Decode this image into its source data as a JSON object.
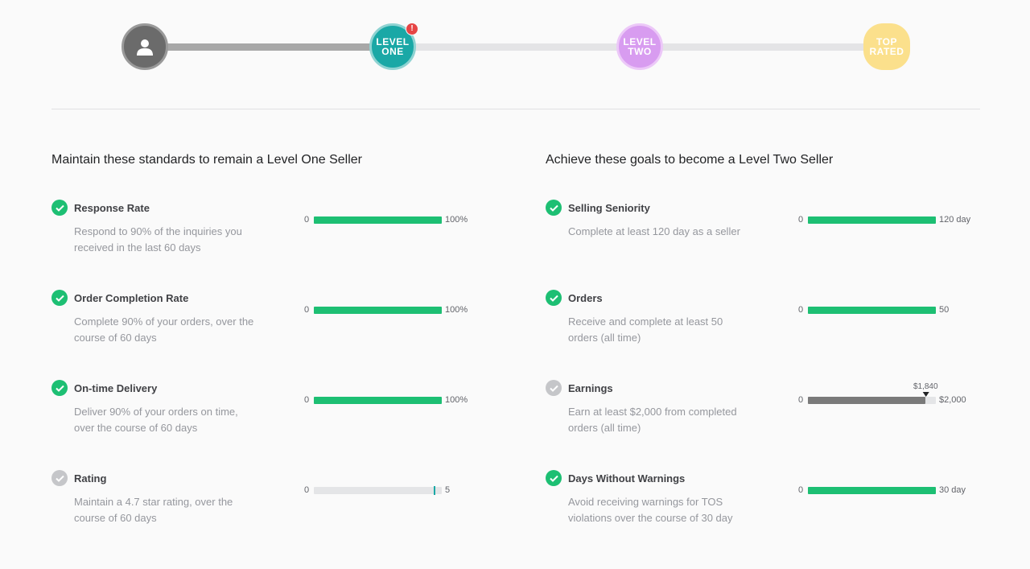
{
  "levels": {
    "level_one": "LEVEL ONE",
    "level_two": "LEVEL TWO",
    "top_rated": "TOP RATED",
    "alert": "!"
  },
  "colors": {
    "green": "#1dbf73",
    "teal": "#1aa8a6",
    "purple": "#d89cf0",
    "gold": "#fbe08c",
    "alert": "#e64545"
  },
  "left_section": {
    "title": "Maintain these standards to remain a Level One Seller",
    "metrics": [
      {
        "name": "Response Rate",
        "description": "Respond to 90% of the inquiries you received in the last 60 days",
        "status": "complete",
        "min": "0",
        "max": "100%",
        "progress": 1.0
      },
      {
        "name": "Order Completion Rate",
        "description": "Complete 90% of your orders, over the course of 60 days",
        "status": "complete",
        "min": "0",
        "max": "100%",
        "progress": 1.0
      },
      {
        "name": "On-time Delivery",
        "description": "Deliver 90% of your orders on time, over the course of 60 days",
        "status": "complete",
        "min": "0",
        "max": "100%",
        "progress": 1.0
      },
      {
        "name": "Rating",
        "description": "Maintain a 4.7 star rating, over the course of 60 days",
        "status": "pending",
        "min": "0",
        "max": "5",
        "progress": 0.0,
        "marker": 0.94
      }
    ]
  },
  "right_section": {
    "title": "Achieve these goals to become a Level Two Seller",
    "metrics": [
      {
        "name": "Selling Seniority",
        "description": "Complete at least 120 day as a seller",
        "status": "complete",
        "min": "0",
        "max": "120 day",
        "progress": 1.0
      },
      {
        "name": "Orders",
        "description": "Receive and complete at least 50 orders (all time)",
        "status": "complete",
        "min": "0",
        "max": "50",
        "progress": 1.0
      },
      {
        "name": "Earnings",
        "description": "Earn at least $2,000 from completed orders (all time)",
        "status": "pending",
        "min": "0",
        "max": "$2,000",
        "progress": 0.92,
        "current": "$1,840"
      },
      {
        "name": "Days Without Warnings",
        "description": "Avoid receiving warnings for TOS violations over the course of 30 day",
        "status": "complete",
        "min": "0",
        "max": "30 day",
        "progress": 1.0
      }
    ]
  }
}
